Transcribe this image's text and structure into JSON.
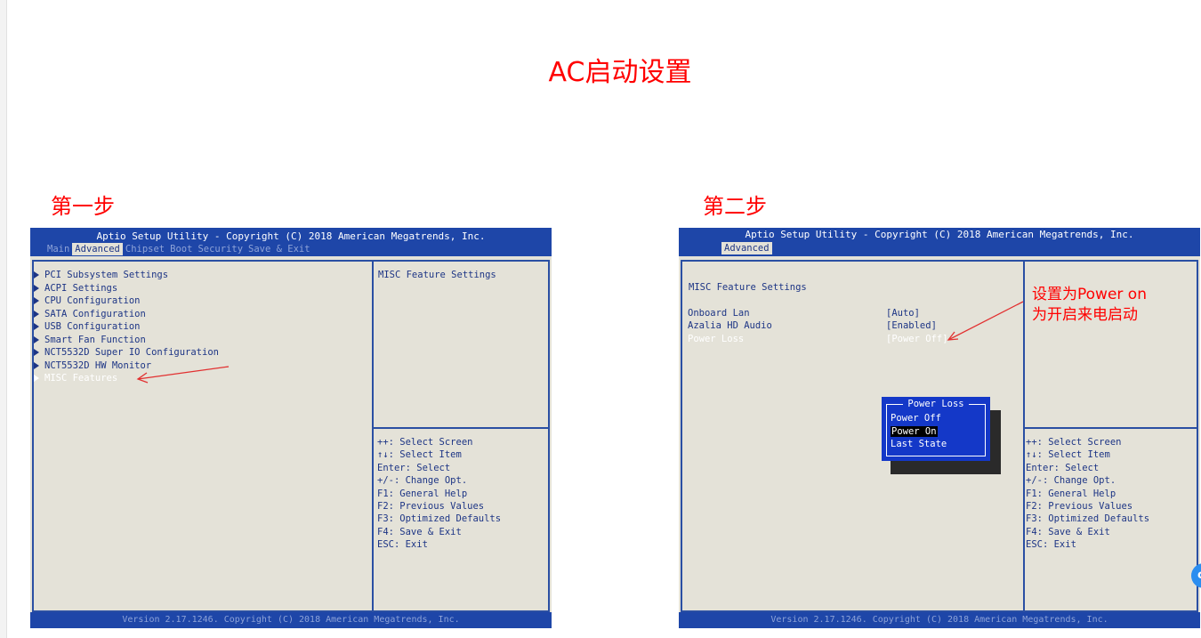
{
  "page": {
    "title": "AC启动设置"
  },
  "steps": [
    {
      "label": "第一步"
    },
    {
      "label": "第二步"
    }
  ],
  "bios_common": {
    "header_title": "Aptio Setup Utility - Copyright (C) 2018 American Megatrends, Inc.",
    "footer": "Version 2.17.1246. Copyright (C) 2018 American Megatrends, Inc.",
    "key_help": [
      "++: Select Screen",
      "↑↓: Select Item",
      "Enter: Select",
      "+/-: Change Opt.",
      "F1: General Help",
      "F2: Previous Values",
      "F3: Optimized Defaults",
      "F4: Save & Exit",
      "ESC: Exit"
    ],
    "colors": {
      "bios_blue": "#1e46a8",
      "bios_bg": "#e4e2d8",
      "bios_text": "#1d3585",
      "annotation_red": "#ff0000"
    }
  },
  "screen1": {
    "tabs": [
      "Main",
      "Advanced",
      "Chipset",
      "Boot",
      "Security",
      "Save & Exit"
    ],
    "active_tab": "Advanced",
    "menu_items": [
      "PCI Subsystem Settings",
      "ACPI Settings",
      "CPU Configuration",
      "SATA Configuration",
      "USB Configuration",
      "Smart Fan Function",
      "NCT5532D Super IO Configuration",
      "NCT5532D HW Monitor",
      "MISC Features"
    ],
    "selected_item": "MISC Features",
    "help_title": "MISC Feature Settings"
  },
  "screen2": {
    "tabs": [
      "Advanced"
    ],
    "settings_title": "MISC Feature Settings",
    "settings": [
      {
        "label": "Onboard Lan",
        "value": "[Auto]"
      },
      {
        "label": "Azalia HD Audio",
        "value": "[Enabled]"
      },
      {
        "label": "Power Loss",
        "value": "[Power Off]"
      }
    ],
    "popup": {
      "title": "Power Loss",
      "options": [
        "Power Off",
        "Power On",
        "Last State"
      ],
      "selected": "Power On"
    },
    "annotation": [
      "设置为Power on",
      "为开启来电启动"
    ]
  }
}
